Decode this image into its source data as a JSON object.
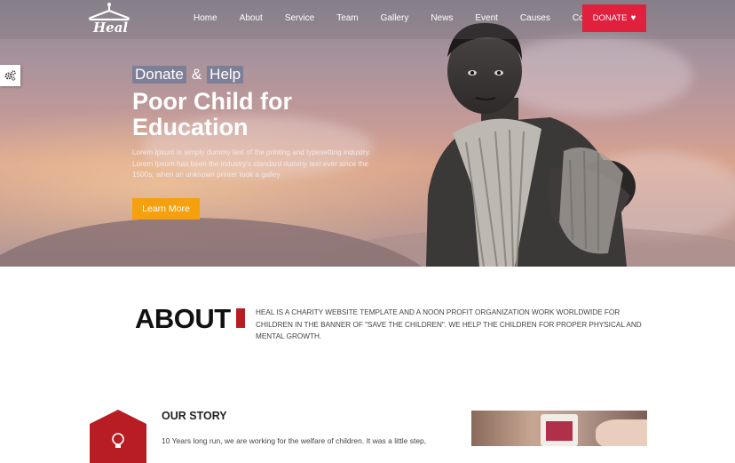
{
  "brand": {
    "logo_text": "Heal"
  },
  "nav": {
    "items": [
      "Home",
      "About",
      "Service",
      "Team",
      "Gallery",
      "News",
      "Event",
      "Causes",
      "Contact"
    ],
    "donate_label": "DONATE"
  },
  "hero": {
    "tag_word1": "Donate",
    "tag_amp": "&",
    "tag_word2": "Help",
    "headline": "Poor Child for Education",
    "description": "Lorem Ipsum is simply dummy text of the printing and typesetting industry. Lorem Ipsum has been the industry's standard dummy text ever since the 1500s, when an unknown printer took a galley",
    "cta_label": "Learn More"
  },
  "about": {
    "title": "ABOUT",
    "text": "Heal is a charity website template and a noon profit organization work worldwide for children in the banner of \"save the children\". We help the children for proper physical and mental growth."
  },
  "story": {
    "title": "OUR STORY",
    "text": "10 Years long run, we are working for the welfare of children. It was a little step,"
  },
  "colors": {
    "accent": "#e0203c",
    "cta": "#f5a00f",
    "about_bar": "#b81d24",
    "hex_badge": "#b81d24"
  }
}
